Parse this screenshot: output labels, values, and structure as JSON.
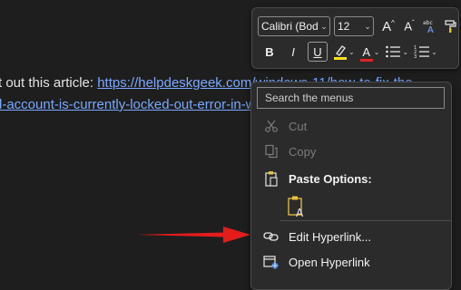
{
  "document": {
    "line1_prefix": "t out this article: ",
    "line1_link": "https://helpdeskgeek.com/windows-11/how-to-fix-the-",
    "line2_link": "d-account-is-currently-locked-out-error-in-w"
  },
  "mini_toolbar": {
    "font_name": "Calibri (Body",
    "font_size": "12",
    "grow_font": "A^",
    "shrink_font": "Aˇ",
    "styles": "abc",
    "bold": "B",
    "italic": "I",
    "underline": "U",
    "font_color_letter": "A",
    "highlight_color": "#f5e11b",
    "font_color": "#e02424"
  },
  "context_menu": {
    "search_placeholder": "Search the menus",
    "items": [
      {
        "label": "Cut",
        "icon": "scissors-icon",
        "disabled": true
      },
      {
        "label": "Copy",
        "icon": "copy-icon",
        "disabled": true
      },
      {
        "label": "Paste Options:",
        "icon": "paste-icon",
        "disabled": false
      },
      {
        "label": "Edit Hyperlink...",
        "icon": "edit-link-icon",
        "disabled": false
      },
      {
        "label": "Open Hyperlink",
        "icon": "open-link-icon",
        "disabled": false
      }
    ]
  },
  "annotation": {
    "arrow_color": "#e31c1c"
  }
}
